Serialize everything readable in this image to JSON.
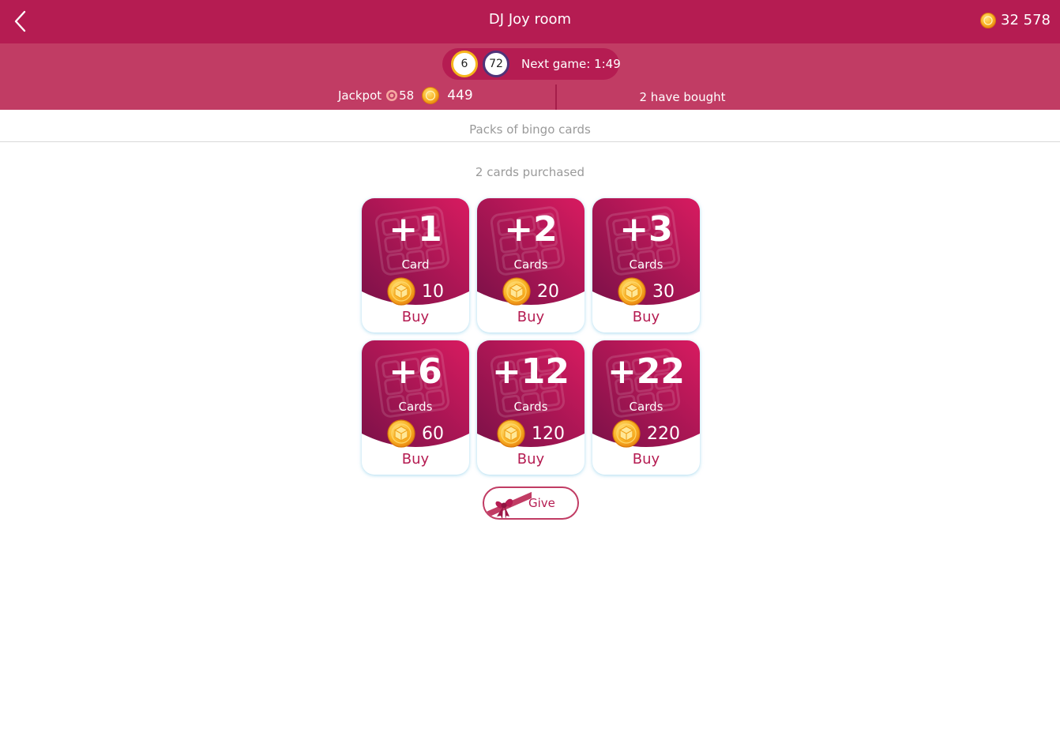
{
  "header": {
    "title": "DJ Joy room",
    "balance": "32 578"
  },
  "game_info": {
    "ball_1": "6",
    "ball_2": "72",
    "next_game": "Next game: 1:49",
    "jackpot_label": "Jackpot",
    "jackpot_balls": "58",
    "jackpot_coins": "449",
    "bought_text": "2 have bought"
  },
  "section": {
    "title": "Packs of bingo cards",
    "purchased_text": "2 cards purchased"
  },
  "packs": [
    {
      "amount": "+1",
      "unit": "Card",
      "price": "10",
      "buy_label": "Buy"
    },
    {
      "amount": "+2",
      "unit": "Cards",
      "price": "20",
      "buy_label": "Buy"
    },
    {
      "amount": "+3",
      "unit": "Cards",
      "price": "30",
      "buy_label": "Buy"
    },
    {
      "amount": "+6",
      "unit": "Cards",
      "price": "60",
      "buy_label": "Buy"
    },
    {
      "amount": "+12",
      "unit": "Cards",
      "price": "120",
      "buy_label": "Buy"
    },
    {
      "amount": "+22",
      "unit": "Cards",
      "price": "220",
      "buy_label": "Buy"
    }
  ],
  "give_button": {
    "label": "Give"
  },
  "icons": {
    "back": "chevron-left-icon",
    "coin": "coin-icon",
    "target": "target-icon",
    "gift": "gift-bow-icon",
    "card_bg": "bingo-grid-icon"
  },
  "colors": {
    "primary": "#b51c52",
    "secondary": "#c13c64",
    "card_gradient_top": "#d81b60",
    "card_gradient_bottom": "#7b1148",
    "coin": "#f6a01a",
    "ball_yellow": "#f6b51c",
    "ball_purple": "#4f3379"
  }
}
